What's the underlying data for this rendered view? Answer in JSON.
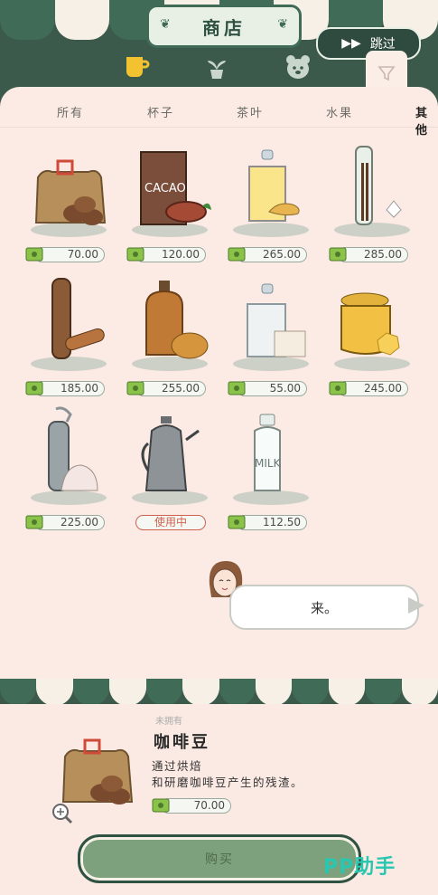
{
  "header": {
    "title": "商店",
    "skip_label": "跳过"
  },
  "category_icons": [
    "cup-icon",
    "plant-icon",
    "bear-icon"
  ],
  "tabs": [
    "所有",
    "杯子",
    "茶叶",
    "水果",
    "其他"
  ],
  "active_tab": 4,
  "items": [
    {
      "name": "coffee-beans-bag",
      "price": "70.00"
    },
    {
      "name": "cacao",
      "price": "120.00",
      "label": "CACAO"
    },
    {
      "name": "ginger-jar",
      "price": "265.00"
    },
    {
      "name": "vanilla-bottle",
      "price": "285.00"
    },
    {
      "name": "cinnamon-mill",
      "price": "185.00"
    },
    {
      "name": "syrup-bottle",
      "price": "255.00"
    },
    {
      "name": "sugar-jar",
      "price": "55.00"
    },
    {
      "name": "honey-jar",
      "price": "245.00"
    },
    {
      "name": "cream-siphon",
      "price": "225.00"
    },
    {
      "name": "kettle",
      "price": "使用中"
    },
    {
      "name": "milk-bottle",
      "price": "112.50",
      "label": "MILK"
    }
  ],
  "dialog": {
    "text": "来。"
  },
  "detail": {
    "tag": "未拥有",
    "name": "咖啡豆",
    "desc_line1": "通过烘焙",
    "desc_line2": "和研磨咖啡豆产生的残渣。",
    "price": "70.00",
    "buy_label": "购买"
  },
  "watermark": "PP助手",
  "colors": {
    "green_dark": "#3f6b57",
    "panel": "#fcebe4",
    "buy": "#7ea17d"
  }
}
